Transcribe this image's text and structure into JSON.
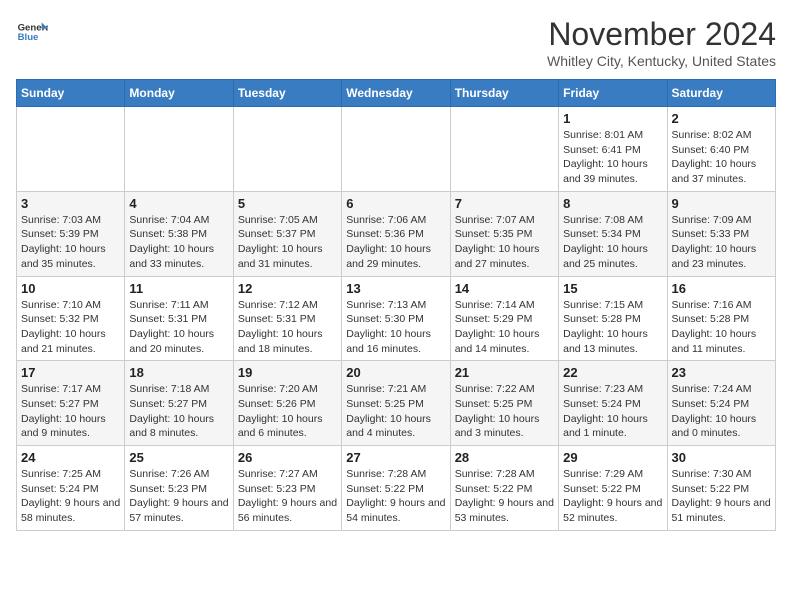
{
  "header": {
    "logo_line1": "General",
    "logo_line2": "Blue",
    "month": "November 2024",
    "location": "Whitley City, Kentucky, United States"
  },
  "weekdays": [
    "Sunday",
    "Monday",
    "Tuesday",
    "Wednesday",
    "Thursday",
    "Friday",
    "Saturday"
  ],
  "weeks": [
    [
      {
        "day": "",
        "info": ""
      },
      {
        "day": "",
        "info": ""
      },
      {
        "day": "",
        "info": ""
      },
      {
        "day": "",
        "info": ""
      },
      {
        "day": "",
        "info": ""
      },
      {
        "day": "1",
        "info": "Sunrise: 8:01 AM\nSunset: 6:41 PM\nDaylight: 10 hours and 39 minutes."
      },
      {
        "day": "2",
        "info": "Sunrise: 8:02 AM\nSunset: 6:40 PM\nDaylight: 10 hours and 37 minutes."
      }
    ],
    [
      {
        "day": "3",
        "info": "Sunrise: 7:03 AM\nSunset: 5:39 PM\nDaylight: 10 hours and 35 minutes."
      },
      {
        "day": "4",
        "info": "Sunrise: 7:04 AM\nSunset: 5:38 PM\nDaylight: 10 hours and 33 minutes."
      },
      {
        "day": "5",
        "info": "Sunrise: 7:05 AM\nSunset: 5:37 PM\nDaylight: 10 hours and 31 minutes."
      },
      {
        "day": "6",
        "info": "Sunrise: 7:06 AM\nSunset: 5:36 PM\nDaylight: 10 hours and 29 minutes."
      },
      {
        "day": "7",
        "info": "Sunrise: 7:07 AM\nSunset: 5:35 PM\nDaylight: 10 hours and 27 minutes."
      },
      {
        "day": "8",
        "info": "Sunrise: 7:08 AM\nSunset: 5:34 PM\nDaylight: 10 hours and 25 minutes."
      },
      {
        "day": "9",
        "info": "Sunrise: 7:09 AM\nSunset: 5:33 PM\nDaylight: 10 hours and 23 minutes."
      }
    ],
    [
      {
        "day": "10",
        "info": "Sunrise: 7:10 AM\nSunset: 5:32 PM\nDaylight: 10 hours and 21 minutes."
      },
      {
        "day": "11",
        "info": "Sunrise: 7:11 AM\nSunset: 5:31 PM\nDaylight: 10 hours and 20 minutes."
      },
      {
        "day": "12",
        "info": "Sunrise: 7:12 AM\nSunset: 5:31 PM\nDaylight: 10 hours and 18 minutes."
      },
      {
        "day": "13",
        "info": "Sunrise: 7:13 AM\nSunset: 5:30 PM\nDaylight: 10 hours and 16 minutes."
      },
      {
        "day": "14",
        "info": "Sunrise: 7:14 AM\nSunset: 5:29 PM\nDaylight: 10 hours and 14 minutes."
      },
      {
        "day": "15",
        "info": "Sunrise: 7:15 AM\nSunset: 5:28 PM\nDaylight: 10 hours and 13 minutes."
      },
      {
        "day": "16",
        "info": "Sunrise: 7:16 AM\nSunset: 5:28 PM\nDaylight: 10 hours and 11 minutes."
      }
    ],
    [
      {
        "day": "17",
        "info": "Sunrise: 7:17 AM\nSunset: 5:27 PM\nDaylight: 10 hours and 9 minutes."
      },
      {
        "day": "18",
        "info": "Sunrise: 7:18 AM\nSunset: 5:27 PM\nDaylight: 10 hours and 8 minutes."
      },
      {
        "day": "19",
        "info": "Sunrise: 7:20 AM\nSunset: 5:26 PM\nDaylight: 10 hours and 6 minutes."
      },
      {
        "day": "20",
        "info": "Sunrise: 7:21 AM\nSunset: 5:25 PM\nDaylight: 10 hours and 4 minutes."
      },
      {
        "day": "21",
        "info": "Sunrise: 7:22 AM\nSunset: 5:25 PM\nDaylight: 10 hours and 3 minutes."
      },
      {
        "day": "22",
        "info": "Sunrise: 7:23 AM\nSunset: 5:24 PM\nDaylight: 10 hours and 1 minute."
      },
      {
        "day": "23",
        "info": "Sunrise: 7:24 AM\nSunset: 5:24 PM\nDaylight: 10 hours and 0 minutes."
      }
    ],
    [
      {
        "day": "24",
        "info": "Sunrise: 7:25 AM\nSunset: 5:24 PM\nDaylight: 9 hours and 58 minutes."
      },
      {
        "day": "25",
        "info": "Sunrise: 7:26 AM\nSunset: 5:23 PM\nDaylight: 9 hours and 57 minutes."
      },
      {
        "day": "26",
        "info": "Sunrise: 7:27 AM\nSunset: 5:23 PM\nDaylight: 9 hours and 56 minutes."
      },
      {
        "day": "27",
        "info": "Sunrise: 7:28 AM\nSunset: 5:22 PM\nDaylight: 9 hours and 54 minutes."
      },
      {
        "day": "28",
        "info": "Sunrise: 7:28 AM\nSunset: 5:22 PM\nDaylight: 9 hours and 53 minutes."
      },
      {
        "day": "29",
        "info": "Sunrise: 7:29 AM\nSunset: 5:22 PM\nDaylight: 9 hours and 52 minutes."
      },
      {
        "day": "30",
        "info": "Sunrise: 7:30 AM\nSunset: 5:22 PM\nDaylight: 9 hours and 51 minutes."
      }
    ]
  ]
}
